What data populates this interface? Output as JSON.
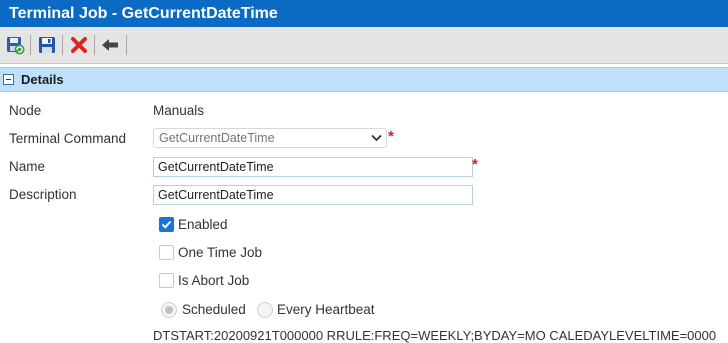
{
  "window": {
    "title": "Terminal Job - GetCurrentDateTime"
  },
  "toolbar": {
    "buttons": [
      {
        "icon": "save-and-new-icon"
      },
      {
        "icon": "save-icon"
      },
      {
        "icon": "delete-icon"
      },
      {
        "icon": "back-icon"
      }
    ]
  },
  "section": {
    "title": "Details"
  },
  "form": {
    "node": {
      "label": "Node",
      "value": "Manuals"
    },
    "terminal_command": {
      "label": "Terminal Command",
      "value": "GetCurrentDateTime",
      "required": "*"
    },
    "name": {
      "label": "Name",
      "value": "GetCurrentDateTime",
      "required": "*"
    },
    "description": {
      "label": "Description",
      "value": "GetCurrentDateTime"
    },
    "enabled": {
      "label": "Enabled",
      "checked": true
    },
    "one_time_job": {
      "label": "One Time Job",
      "checked": false
    },
    "is_abort_job": {
      "label": "Is Abort Job",
      "checked": false
    },
    "schedule_type": {
      "options": [
        "Scheduled",
        "Every Heartbeat"
      ],
      "selected": "Scheduled"
    },
    "schedule_rule": "DTSTART:20200921T000000 RRULE:FREQ=WEEKLY;BYDAY=MO CALEDAYLEVELTIME=0000"
  },
  "colors": {
    "title_bar": "#0b6bc4",
    "section_header": "#bfe0f9",
    "required_marker": "#d21c1c",
    "checkbox_checked": "#1a73d9"
  }
}
